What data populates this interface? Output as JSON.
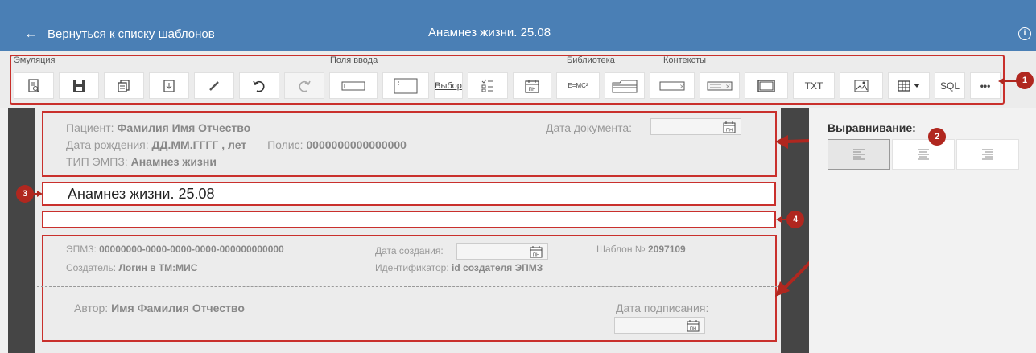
{
  "header": {
    "back_label": "Вернуться к списку шаблонов",
    "back_arrow": "←",
    "title": "Анамнез жизни. 25.08",
    "info_glyph": "i"
  },
  "toolbar": {
    "groups": {
      "emulation": "Эмуляция",
      "input_fields": "Поля ввода",
      "library": "Библиотека",
      "contexts": "Контексты"
    },
    "select_label": "Выбор",
    "formula_label": "E=MC²",
    "txt_label": "TXT",
    "sql_label": "SQL",
    "more_label": "•••"
  },
  "markers": {
    "m1": "1",
    "m2": "2",
    "m3": "3",
    "m4": "4"
  },
  "header_section": {
    "patient_label": "Пациент:",
    "patient_value": "Фамилия Имя Отчество",
    "birth_label": "Дата рождения:",
    "birth_value": "ДД.ММ.ГГГГ , лет",
    "policy_label": "Полис:",
    "policy_value": "0000000000000000",
    "type_label": "ТИП ЭМПЗ:",
    "type_value": "Анамнез жизни",
    "doc_date_label": "Дата документа:"
  },
  "title_field": {
    "value": "Анамнез жизни. 25.08"
  },
  "footer_section": {
    "empz_label": "ЭПМЗ:",
    "empz_value": "00000000-0000-0000-0000-000000000000",
    "created_label": "Дата создания:",
    "template_label": "Шаблон №",
    "template_value": "2097109",
    "creator_label": "Создатель:",
    "creator_value": "Логин в ТМ:МИС",
    "identifier_label": "Идентификатор:",
    "identifier_value": "id создателя ЭПМЗ",
    "author_label": "Автор:",
    "author_value": "Имя Фамилия Отчество",
    "sign_date_label": "Дата подписания:"
  },
  "calendar_glyph": "ПН",
  "right_panel": {
    "align_label": "Выравнивание:"
  },
  "colors": {
    "header_bg": "#4a7fb5",
    "accent_red": "#c9302c",
    "marker_red": "#b0271f",
    "editor_bg": "#454545"
  }
}
